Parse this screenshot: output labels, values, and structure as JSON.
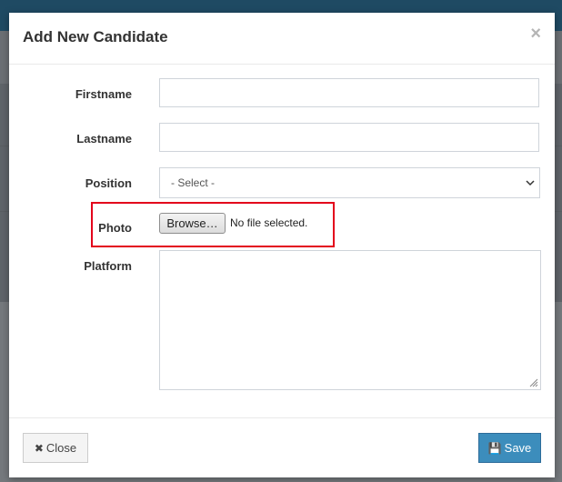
{
  "modal": {
    "title": "Add New Candidate",
    "close_symbol": "×"
  },
  "form": {
    "firstname_label": "Firstname",
    "lastname_label": "Lastname",
    "position_label": "Position",
    "position_selected": "- Select -",
    "photo_label": "Photo",
    "photo_button": "Browse…",
    "photo_status": "No file selected.",
    "platform_label": "Platform"
  },
  "footer": {
    "close_label": "Close",
    "close_icon": "✖",
    "save_label": "Save",
    "save_icon": "💾"
  },
  "colors": {
    "primary": "#3c8dbc",
    "highlight": "#e3001b"
  }
}
